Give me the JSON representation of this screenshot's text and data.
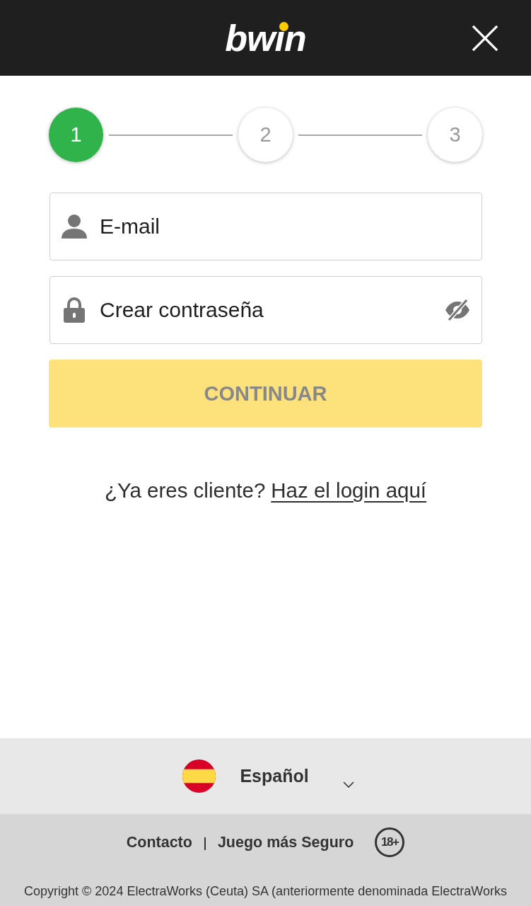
{
  "header": {
    "logo": "bwin"
  },
  "stepper": {
    "steps": [
      {
        "label": "1",
        "selected": true
      },
      {
        "label": "2",
        "selected": false
      },
      {
        "label": "3",
        "selected": false
      }
    ]
  },
  "form": {
    "fields": [
      {
        "kind": "email",
        "placeholder": "E-mail"
      },
      {
        "kind": "password",
        "placeholder": "Crear contraseña",
        "password_visible": false
      }
    ],
    "submit": {
      "label": "CONTINUAR",
      "disabled": true
    }
  },
  "login_prompt": {
    "text": "¿Ya eres cliente?",
    "link": "Haz el login aquí"
  },
  "footer": {
    "language": {
      "label": "Español"
    },
    "links": [
      "Contacto",
      "Juego más Seguro"
    ],
    "age_badge": "18+",
    "copyright": "Copyright © 2024 ElectraWorks (Ceuta) SA (anteriormente denominada ElectraWorks"
  }
}
